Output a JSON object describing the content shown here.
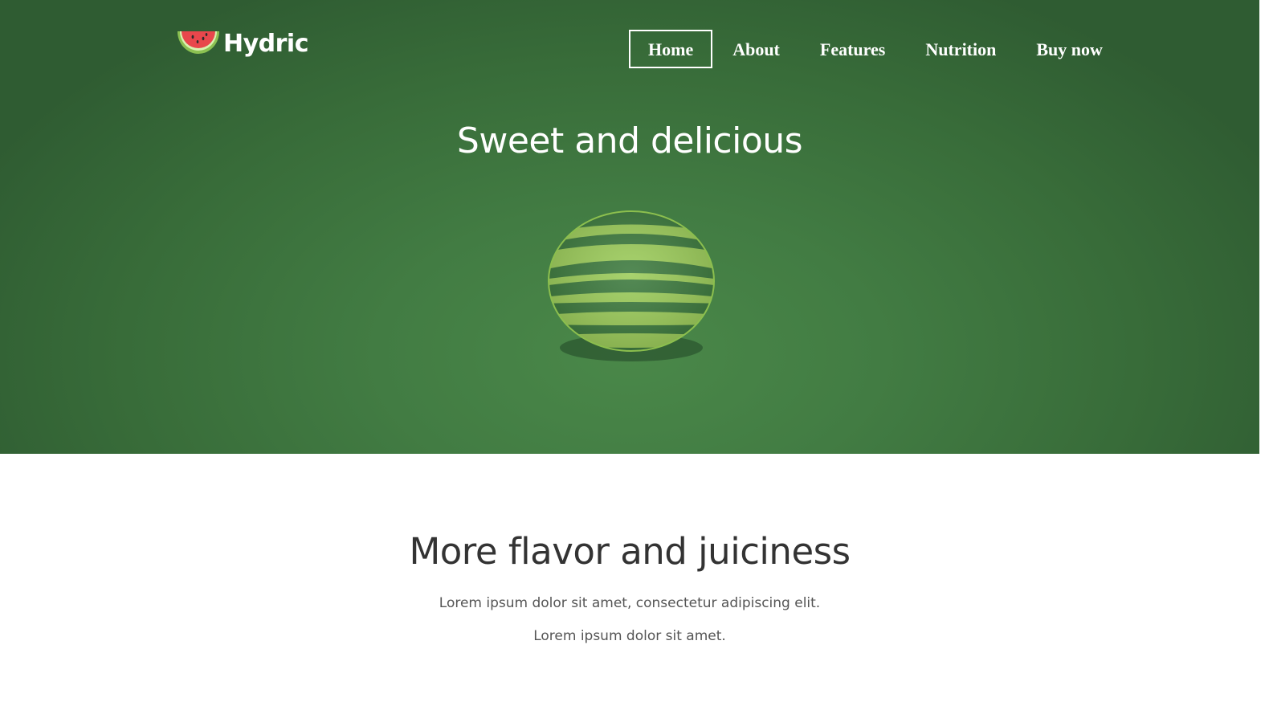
{
  "brand": {
    "name": "Hydric",
    "icon": "watermelon-slice-icon"
  },
  "nav": {
    "items": [
      {
        "label": "Home",
        "active": true
      },
      {
        "label": "About",
        "active": false
      },
      {
        "label": "Features",
        "active": false
      },
      {
        "label": "Nutrition",
        "active": false
      },
      {
        "label": "Buy now",
        "active": false
      }
    ]
  },
  "hero": {
    "title": "Sweet and delicious",
    "image": "watermelon-illustration",
    "colors": {
      "background_center": "#4a8849",
      "background_edge": "#2f5c32",
      "rind_light": "#9ccc5a",
      "rind_dark": "#3d7a3e"
    }
  },
  "content": {
    "title": "More flavor and juiciness",
    "lines": [
      "Lorem ipsum dolor sit amet, consectetur adipiscing elit.",
      "Lorem ipsum dolor sit amet."
    ]
  }
}
